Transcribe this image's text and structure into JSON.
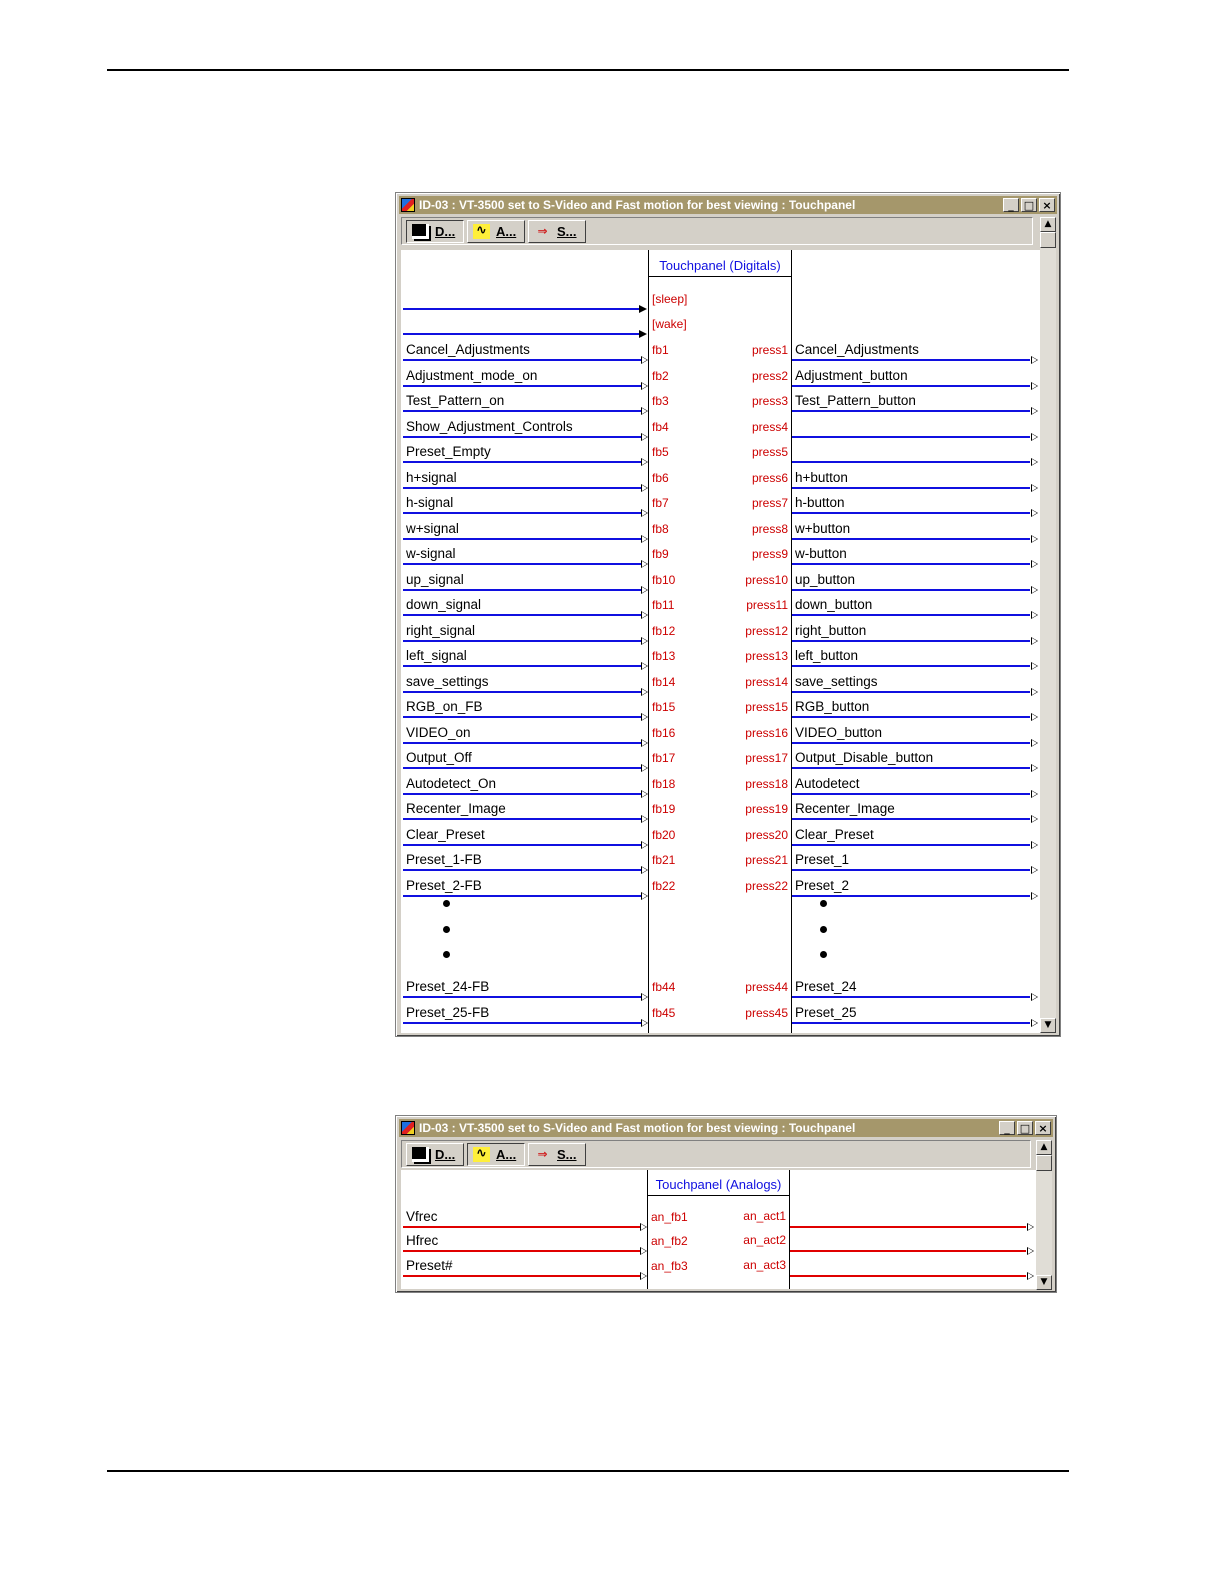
{
  "window_title": "ID-03 : VT-3500 set to S-Video and Fast motion for best viewing : Touchpanel",
  "window_buttons": [
    "_",
    "□",
    "×"
  ],
  "toolbar": {
    "d_label": "D...",
    "a_label": "A...",
    "s_label": "S..."
  },
  "digitals": {
    "title": "Touchpanel (Digitals)",
    "sleep": "[sleep]",
    "wake": "[wake]",
    "rows": [
      {
        "in": "Cancel_Adjustments",
        "fb": "fb1",
        "press": "press1",
        "out": "Cancel_Adjustments"
      },
      {
        "in": "Adjustment_mode_on",
        "fb": "fb2",
        "press": "press2",
        "out": "Adjustment_button"
      },
      {
        "in": "Test_Pattern_on",
        "fb": "fb3",
        "press": "press3",
        "out": "Test_Pattern_button"
      },
      {
        "in": "Show_Adjustment_Controls",
        "fb": "fb4",
        "press": "press4",
        "out": ""
      },
      {
        "in": "Preset_Empty",
        "fb": "fb5",
        "press": "press5",
        "out": ""
      },
      {
        "in": "h+signal",
        "fb": "fb6",
        "press": "press6",
        "out": "h+button"
      },
      {
        "in": "h-signal",
        "fb": "fb7",
        "press": "press7",
        "out": "h-button"
      },
      {
        "in": "w+signal",
        "fb": "fb8",
        "press": "press8",
        "out": "w+button"
      },
      {
        "in": "w-signal",
        "fb": "fb9",
        "press": "press9",
        "out": "w-button"
      },
      {
        "in": "up_signal",
        "fb": "fb10",
        "press": "press10",
        "out": "up_button"
      },
      {
        "in": "down_signal",
        "fb": "fb11",
        "press": "press11",
        "out": "down_button"
      },
      {
        "in": "right_signal",
        "fb": "fb12",
        "press": "press12",
        "out": "right_button"
      },
      {
        "in": "left_signal",
        "fb": "fb13",
        "press": "press13",
        "out": "left_button"
      },
      {
        "in": "save_settings",
        "fb": "fb14",
        "press": "press14",
        "out": "save_settings"
      },
      {
        "in": "RGB_on_FB",
        "fb": "fb15",
        "press": "press15",
        "out": "RGB_button"
      },
      {
        "in": "VIDEO_on",
        "fb": "fb16",
        "press": "press16",
        "out": "VIDEO_button"
      },
      {
        "in": "Output_Off",
        "fb": "fb17",
        "press": "press17",
        "out": "Output_Disable_button"
      },
      {
        "in": "Autodetect_On",
        "fb": "fb18",
        "press": "press18",
        "out": "Autodetect"
      },
      {
        "in": "Recenter_Image",
        "fb": "fb19",
        "press": "press19",
        "out": "Recenter_Image"
      },
      {
        "in": "Clear_Preset",
        "fb": "fb20",
        "press": "press20",
        "out": "Clear_Preset"
      },
      {
        "in": "Preset_1-FB",
        "fb": "fb21",
        "press": "press21",
        "out": "Preset_1"
      },
      {
        "in": "Preset_2-FB",
        "fb": "fb22",
        "press": "press22",
        "out": "Preset_2"
      }
    ],
    "tail_rows": [
      {
        "in": "Preset_24-FB",
        "fb": "fb44",
        "press": "press44",
        "out": "Preset_24"
      },
      {
        "in": "Preset_25-FB",
        "fb": "fb45",
        "press": "press45",
        "out": "Preset_25"
      }
    ]
  },
  "analogs": {
    "title": "Touchpanel (Analogs)",
    "rows": [
      {
        "in": "Vfrec",
        "fb": "an_fb1",
        "act": "an_act1"
      },
      {
        "in": "Hfrec",
        "fb": "an_fb2",
        "act": "an_act2"
      },
      {
        "in": "Preset#",
        "fb": "an_fb3",
        "act": "an_act3"
      }
    ]
  }
}
